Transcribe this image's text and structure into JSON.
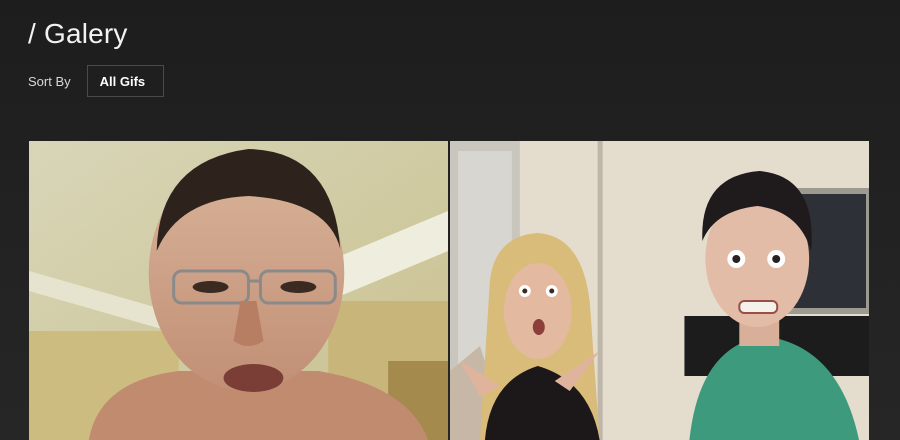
{
  "header": {
    "title": "/ Galery"
  },
  "sort": {
    "label": "Sort By",
    "selected": "All Gifs"
  },
  "gallery": {
    "items": [
      {
        "name": "gif-tile-1"
      },
      {
        "name": "gif-tile-2"
      }
    ]
  },
  "colors": {
    "background": "#1f1f1f",
    "text": "#ffffff",
    "select_border": "#4a4a4a"
  }
}
